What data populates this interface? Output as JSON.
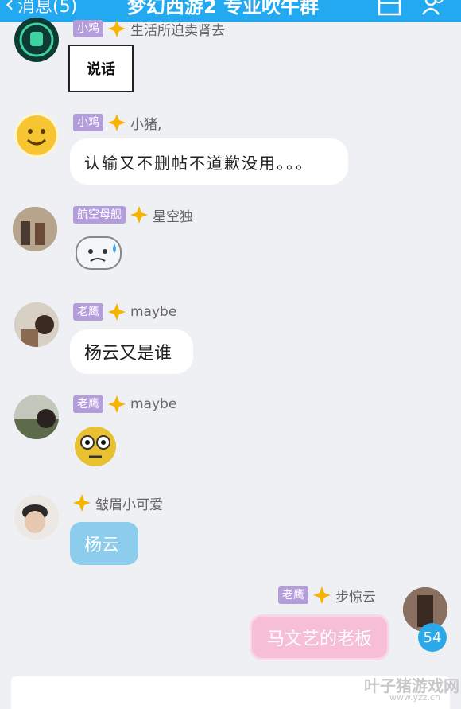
{
  "header": {
    "back_label": "消息(5)",
    "title": "梦幻西游2 专业吹牛群"
  },
  "messages": [
    {
      "badge": "小鸡",
      "sender": "生活所迫卖肾去",
      "content": "说话"
    },
    {
      "badge": "小鸡",
      "sender": "小猪,",
      "content": "认输又不删帖不道歉没用。。。"
    },
    {
      "badge": "航空母舰",
      "sender": "星空独",
      "content": ""
    },
    {
      "badge": "老鹰",
      "sender": "maybe",
      "content": "杨云又是谁"
    },
    {
      "badge": "老鹰",
      "sender": "maybe",
      "content": ""
    },
    {
      "badge": "",
      "sender": "皱眉小可爱",
      "content": "杨云"
    },
    {
      "badge": "老鹰",
      "sender": "步惊云",
      "content": "马文艺的老板",
      "unread": "54"
    }
  ],
  "watermark": {
    "brand": "叶子猪游戏网",
    "url": "www.yzz.cn"
  },
  "colors": {
    "header": "#22a9f0",
    "badge": "#b39ddb",
    "background": "#eef0f4"
  }
}
